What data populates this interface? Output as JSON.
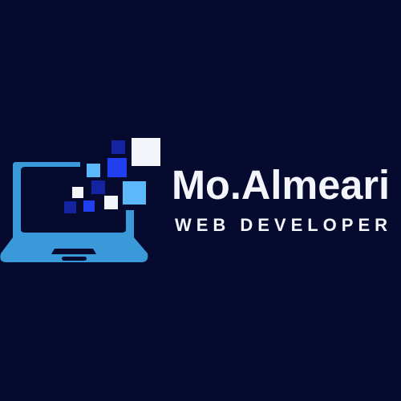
{
  "logo": {
    "name": "Mo.Almeari",
    "tagline": "WEB DEVELOPER"
  },
  "colors": {
    "background": "#050a2e",
    "laptop": "#3a9ad9",
    "light_blue": "#5cb8f8",
    "blue": "#2040f0",
    "dark_blue": "#1424a0",
    "white": "#f4f5fa"
  },
  "icons": [
    "laptop-icon",
    "pixel-squares"
  ]
}
